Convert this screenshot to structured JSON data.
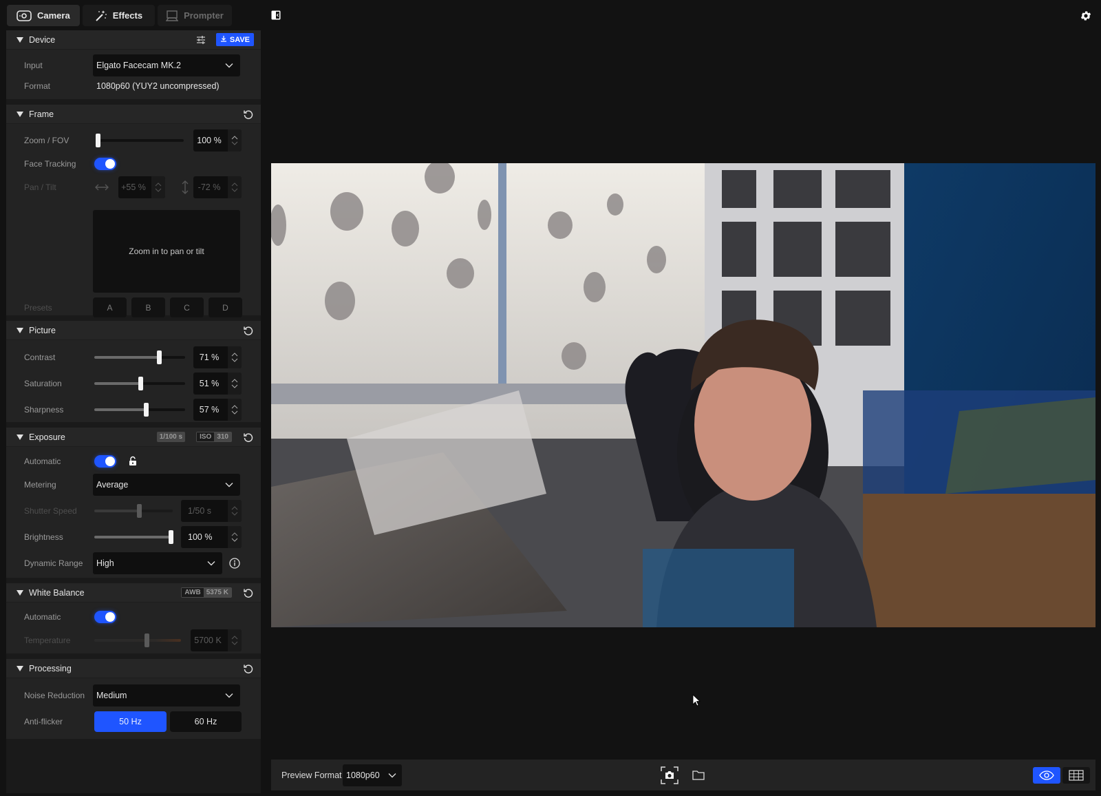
{
  "tabs": [
    {
      "label": "Camera",
      "icon": "camera-icon",
      "active": true
    },
    {
      "label": "Effects",
      "icon": "magic-wand-icon",
      "active": false
    },
    {
      "label": "Prompter",
      "icon": "prompter-icon",
      "active": false,
      "disabled": true
    }
  ],
  "device": {
    "title": "Device",
    "save_label": "SAVE",
    "input_label": "Input",
    "input_value": "Elgato Facecam MK.2",
    "format_label": "Format",
    "format_value": "1080p60 (YUY2 uncompressed)"
  },
  "frame": {
    "title": "Frame",
    "zoom_label": "Zoom / FOV",
    "zoom_value": "100 %",
    "zoom_level": 0.0,
    "face_tracking_label": "Face Tracking",
    "face_tracking_on": true,
    "pan_tilt_label": "Pan / Tilt",
    "pan_value": "+55 %",
    "tilt_value": "-72 %",
    "pad_message": "Zoom in to pan or tilt",
    "presets_label": "Presets",
    "presets": [
      "A",
      "B",
      "C",
      "D"
    ]
  },
  "picture": {
    "title": "Picture",
    "contrast_label": "Contrast",
    "contrast_value": "71 %",
    "contrast_level": 0.71,
    "saturation_label": "Saturation",
    "saturation_value": "51 %",
    "saturation_level": 0.51,
    "sharpness_label": "Sharpness",
    "sharpness_value": "57 %",
    "sharpness_level": 0.57
  },
  "exposure": {
    "title": "Exposure",
    "shutter_badge": "1/100 s",
    "iso_key": "ISO",
    "iso_value": "310",
    "automatic_label": "Automatic",
    "automatic_on": true,
    "metering_label": "Metering",
    "metering_value": "Average",
    "shutter_label": "Shutter Speed",
    "shutter_value": "1/50 s",
    "shutter_level": 0.57,
    "brightness_label": "Brightness",
    "brightness_value": "100 %",
    "brightness_level": 1.0,
    "dynamic_range_label": "Dynamic Range",
    "dynamic_range_value": "High"
  },
  "white_balance": {
    "title": "White Balance",
    "awb_key": "AWB",
    "awb_value": "5375 K",
    "automatic_label": "Automatic",
    "automatic_on": true,
    "temperature_label": "Temperature",
    "temperature_value": "5700 K",
    "temperature_level": 0.6
  },
  "processing": {
    "title": "Processing",
    "noise_label": "Noise Reduction",
    "noise_value": "Medium",
    "antiflicker_label": "Anti-flicker",
    "antiflicker_options": [
      "50 Hz",
      "60 Hz"
    ],
    "antiflicker_selected": "50 Hz"
  },
  "bottom_bar": {
    "preview_format_label": "Preview Format",
    "preview_format_value": "1080p60"
  },
  "colors": {
    "accent": "#1f55ff",
    "background": "#121212",
    "panel": "#232323"
  }
}
